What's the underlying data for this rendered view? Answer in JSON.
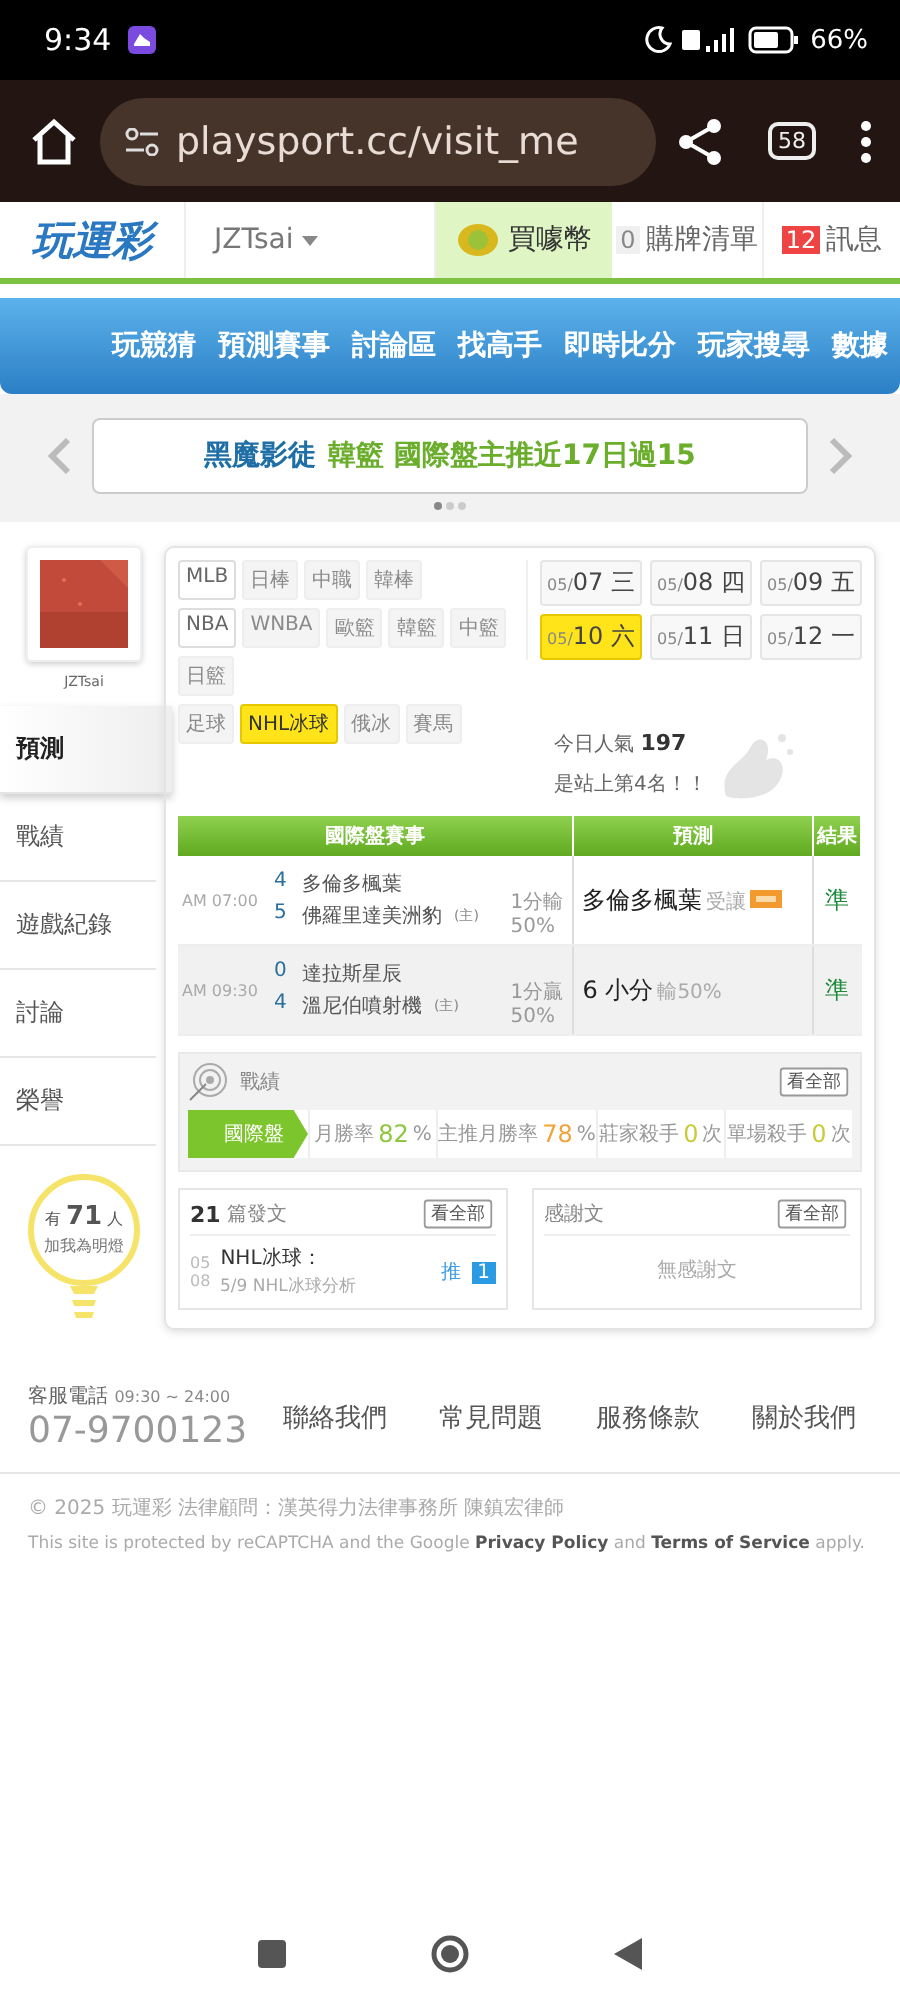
{
  "status_bar": {
    "time": "9:34",
    "battery": "66%"
  },
  "browser": {
    "url": "playsport.cc/visit_me",
    "tab_count": "58"
  },
  "site_header": {
    "logo": "玩運彩",
    "username": "JZTsai",
    "buy_coins": "買噱幣",
    "cart_count": "0",
    "cart": "購牌清單",
    "message_count": "12",
    "messages": "訊息"
  },
  "nav": [
    "玩競猜",
    "預測賽事",
    "討論區",
    "找高手",
    "即時比分",
    "玩家搜尋",
    "數據"
  ],
  "banner": {
    "author": "黑魔影徒",
    "text": "韓籃 國際盤主推近17日過15",
    "dots": [
      {
        "selected": true
      },
      {
        "selected": false
      },
      {
        "selected": false
      }
    ]
  },
  "profile": {
    "username": "JZTsai",
    "menu": [
      {
        "label": "預測",
        "selected": true
      },
      {
        "label": "戰績",
        "selected": false
      },
      {
        "label": "遊戲紀錄",
        "selected": false
      },
      {
        "label": "討論",
        "selected": false
      },
      {
        "label": "榮譽",
        "selected": false
      }
    ],
    "fans": {
      "prefix": "有",
      "count": "71",
      "suffix": "人",
      "caption": "加我為明燈"
    }
  },
  "leagues": [
    [
      {
        "label": "MLB",
        "disabled": false,
        "selected": false
      },
      {
        "label": "日棒",
        "disabled": true,
        "selected": false
      },
      {
        "label": "中職",
        "disabled": true,
        "selected": false
      },
      {
        "label": "韓棒",
        "disabled": true,
        "selected": false
      }
    ],
    [
      {
        "label": "NBA",
        "disabled": false,
        "selected": false
      },
      {
        "label": "WNBA",
        "disabled": true,
        "selected": false
      },
      {
        "label": "歐籃",
        "disabled": true,
        "selected": false
      },
      {
        "label": "韓籃",
        "disabled": true,
        "selected": false
      },
      {
        "label": "中籃",
        "disabled": true,
        "selected": false
      }
    ],
    [
      {
        "label": "日籃",
        "disabled": true,
        "selected": false
      }
    ],
    [
      {
        "label": "足球",
        "disabled": true,
        "selected": false
      },
      {
        "label": "NHL冰球",
        "disabled": false,
        "selected": true
      },
      {
        "label": "俄冰",
        "disabled": true,
        "selected": false
      },
      {
        "label": "賽馬",
        "disabled": true,
        "selected": false
      }
    ]
  ],
  "dates": [
    {
      "month": "05/",
      "day": "07 三",
      "selected": false
    },
    {
      "month": "05/",
      "day": "08 四",
      "selected": false
    },
    {
      "month": "05/",
      "day": "09 五",
      "selected": false
    },
    {
      "month": "05/",
      "day": "10 六",
      "selected": true
    },
    {
      "month": "05/",
      "day": "11 日",
      "selected": false
    },
    {
      "month": "05/",
      "day": "12 一",
      "selected": false
    }
  ],
  "popularity": {
    "label": "今日人氣",
    "count": "197",
    "rank": "是站上第4名！！"
  },
  "predictions": {
    "columns": [
      "國際盤賽事",
      "預測",
      "結果"
    ],
    "rows": [
      {
        "time": "AM 07:00",
        "away_score": "4",
        "away_team": "多倫多楓葉",
        "home_score": "5",
        "home_team": "佛羅里達美洲豹",
        "home_mark": "(主)",
        "line": "1分輸",
        "line_pct": "50%",
        "pick": "多倫多楓葉",
        "pick_note": "受讓",
        "hot": true,
        "result": "準"
      },
      {
        "time": "AM 09:30",
        "away_score": "0",
        "away_team": "達拉斯星辰",
        "home_score": "4",
        "home_team": "溫尼伯噴射機",
        "home_mark": "(主)",
        "line": "1分贏",
        "line_pct": "50%",
        "pick": "6 小分",
        "pick_note": "輸50%",
        "hot": false,
        "result": "準"
      }
    ]
  },
  "record": {
    "title": "戰績",
    "view_all": "看全部",
    "tab": {
      "label": "國際盤",
      "selected": true
    },
    "stats": [
      {
        "label": "月勝率",
        "value": "82",
        "unit": "%",
        "color": "#8dc63f"
      },
      {
        "label": "主推月勝率",
        "value": "78",
        "unit": "%",
        "color": "#f2a33a"
      },
      {
        "label": "莊家殺手",
        "value": "0",
        "unit": "次",
        "color": "#c9c93a"
      },
      {
        "label": "單場殺手",
        "value": "0",
        "unit": "次",
        "color": "#c9c93a"
      }
    ]
  },
  "posts": {
    "count": "21",
    "title": "篇發文",
    "view_all": "看全部",
    "items": [
      {
        "month": "05",
        "day": "08",
        "title": "NHL冰球：",
        "subtitle": "5/9 NHL冰球分析",
        "push_label": "推",
        "push_count": "1"
      }
    ]
  },
  "thanks": {
    "title": "感謝文",
    "view_all": "看全部",
    "empty": "無感謝文"
  },
  "footer": {
    "hours_label": "客服電話",
    "hours": "09:30 ~ 24:00",
    "phone": "07-9700123",
    "links": [
      "聯絡我們",
      "常見問題",
      "服務條款",
      "關於我們"
    ],
    "copyright": "© 2025 玩運彩 法律顧問：漢英得力法律事務所 陳鎮宏律師",
    "recaptcha": "This site is protected by reCAPTCHA and the Google **Privacy Policy** and **Terms of Service** apply."
  }
}
